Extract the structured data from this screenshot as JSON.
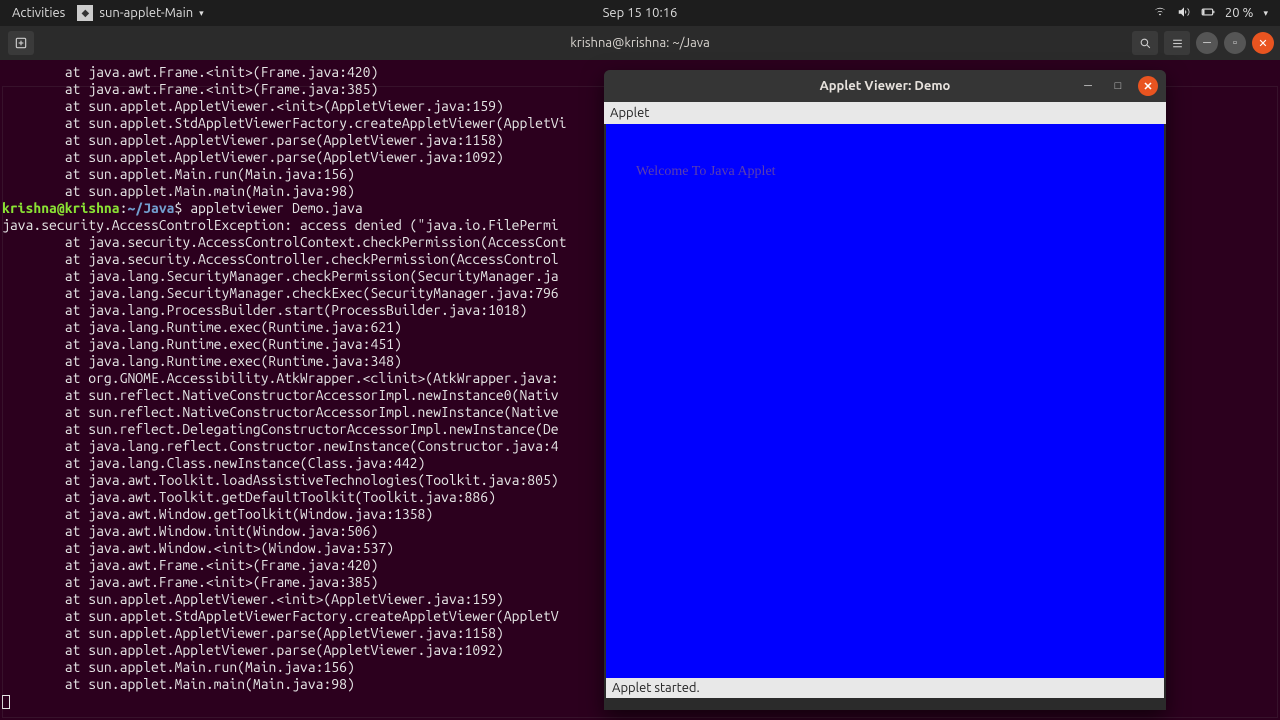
{
  "topbar": {
    "activities": "Activities",
    "app_name": "sun-applet-Main",
    "datetime": "Sep 15  10:16",
    "battery": "20 %"
  },
  "terminal": {
    "title": "krishna@krishna: ~/Java",
    "prompt_user": "krishna@krishna",
    "prompt_sep": ":",
    "prompt_path": "~/Java",
    "prompt_dollar": "$ ",
    "cmd": "appletviewer Demo.java",
    "exception_line": "java.security.AccessControlException: access denied (\"java.io.FilePermi",
    "pre_lines": [
      "        at java.awt.Frame.<init>(Frame.java:420)",
      "        at java.awt.Frame.<init>(Frame.java:385)",
      "        at sun.applet.AppletViewer.<init>(AppletViewer.java:159)",
      "        at sun.applet.StdAppletViewerFactory.createAppletViewer(AppletVi",
      "        at sun.applet.AppletViewer.parse(AppletViewer.java:1158)",
      "        at sun.applet.AppletViewer.parse(AppletViewer.java:1092)",
      "        at sun.applet.Main.run(Main.java:156)",
      "        at sun.applet.Main.main(Main.java:98)"
    ],
    "trace_lines": [
      "        at java.security.AccessControlContext.checkPermission(AccessCont",
      "        at java.security.AccessController.checkPermission(AccessControl",
      "        at java.lang.SecurityManager.checkPermission(SecurityManager.ja",
      "        at java.lang.SecurityManager.checkExec(SecurityManager.java:796",
      "        at java.lang.ProcessBuilder.start(ProcessBuilder.java:1018)",
      "        at java.lang.Runtime.exec(Runtime.java:621)",
      "        at java.lang.Runtime.exec(Runtime.java:451)",
      "        at java.lang.Runtime.exec(Runtime.java:348)",
      "        at org.GNOME.Accessibility.AtkWrapper.<clinit>(AtkWrapper.java:",
      "        at sun.reflect.NativeConstructorAccessorImpl.newInstance0(Nativ",
      "        at sun.reflect.NativeConstructorAccessorImpl.newInstance(Native",
      "        at sun.reflect.DelegatingConstructorAccessorImpl.newInstance(De",
      "        at java.lang.reflect.Constructor.newInstance(Constructor.java:4",
      "        at java.lang.Class.newInstance(Class.java:442)",
      "        at java.awt.Toolkit.loadAssistiveTechnologies(Toolkit.java:805)",
      "        at java.awt.Toolkit.getDefaultToolkit(Toolkit.java:886)",
      "        at java.awt.Window.getToolkit(Window.java:1358)",
      "        at java.awt.Window.init(Window.java:506)",
      "        at java.awt.Window.<init>(Window.java:537)",
      "        at java.awt.Frame.<init>(Frame.java:420)",
      "        at java.awt.Frame.<init>(Frame.java:385)",
      "        at sun.applet.AppletViewer.<init>(AppletViewer.java:159)",
      "        at sun.applet.StdAppletViewerFactory.createAppletViewer(AppletV",
      "        at sun.applet.AppletViewer.parse(AppletViewer.java:1158)",
      "        at sun.applet.AppletViewer.parse(AppletViewer.java:1092)",
      "        at sun.applet.Main.run(Main.java:156)",
      "        at sun.applet.Main.main(Main.java:98)"
    ]
  },
  "applet": {
    "title": "Applet Viewer: Demo",
    "menu": "Applet",
    "canvas_text": "Welcome To Java Applet",
    "status": "Applet started."
  }
}
